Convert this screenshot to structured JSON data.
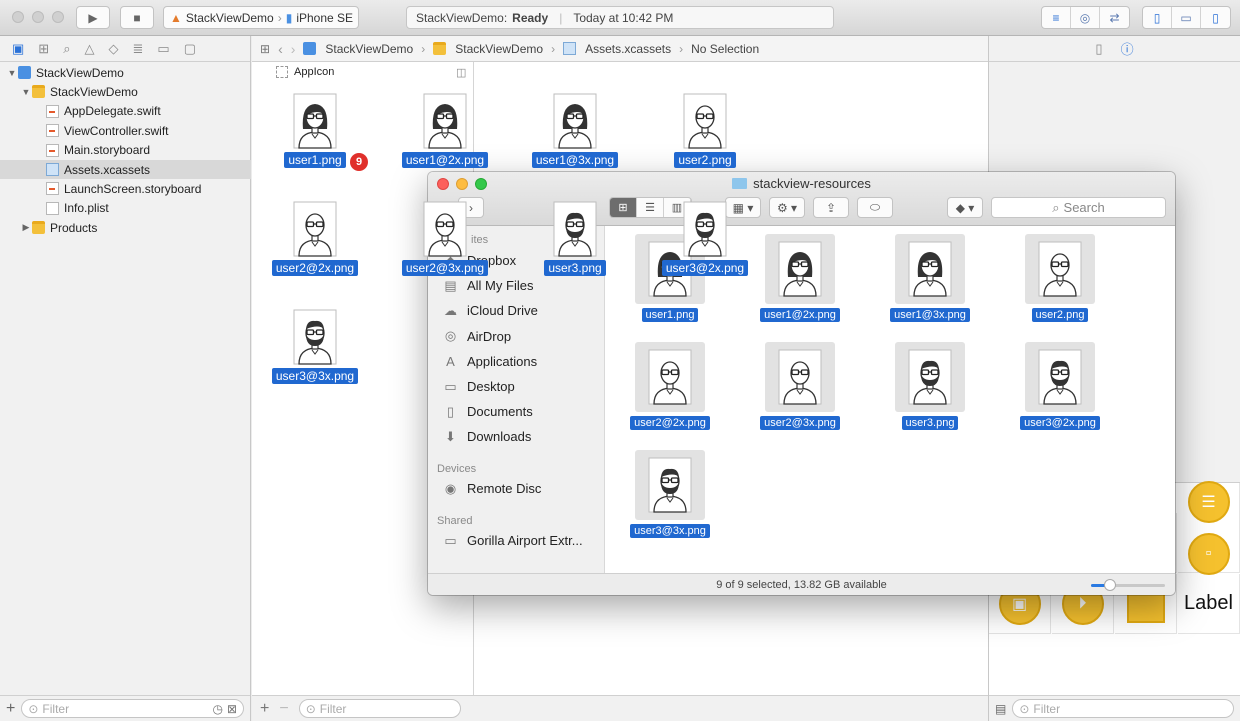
{
  "toolbar": {
    "scheme_project": "StackViewDemo",
    "scheme_device": "iPhone SE",
    "status_project": "StackViewDemo:",
    "status_state": "Ready",
    "status_time": "Today at 10:42 PM"
  },
  "navigator": {
    "tree": [
      {
        "label": "StackViewDemo",
        "kind": "project",
        "indent": 0,
        "open": true
      },
      {
        "label": "StackViewDemo",
        "kind": "folder",
        "indent": 1,
        "open": true
      },
      {
        "label": "AppDelegate.swift",
        "kind": "file",
        "indent": 2
      },
      {
        "label": "ViewController.swift",
        "kind": "file",
        "indent": 2
      },
      {
        "label": "Main.storyboard",
        "kind": "file",
        "indent": 2
      },
      {
        "label": "Assets.xcassets",
        "kind": "assets",
        "indent": 2,
        "selected": true
      },
      {
        "label": "LaunchScreen.storyboard",
        "kind": "file",
        "indent": 2
      },
      {
        "label": "Info.plist",
        "kind": "plist",
        "indent": 2
      },
      {
        "label": "Products",
        "kind": "folder",
        "indent": 1,
        "open": false
      }
    ],
    "filter_placeholder": "Filter"
  },
  "jumpbar": {
    "crumbs": [
      "StackViewDemo",
      "StackViewDemo",
      "Assets.xcassets",
      "No Selection"
    ]
  },
  "asset_list": {
    "appicon": "AppIcon",
    "filter_placeholder": "Filter"
  },
  "drag": {
    "badge_count": "9",
    "items": [
      {
        "label": "user1.png",
        "avatar": "woman"
      },
      {
        "label": "user1@2x.png",
        "avatar": "woman"
      },
      {
        "label": "user1@3x.png",
        "avatar": "woman"
      },
      {
        "label": "user2.png",
        "avatar": "bald"
      },
      {
        "label": "user2@2x.png",
        "avatar": "bald"
      },
      {
        "label": "user2@3x.png",
        "avatar": "bald"
      },
      {
        "label": "user3.png",
        "avatar": "beard"
      },
      {
        "label": "user3@2x.png",
        "avatar": "beard"
      },
      {
        "label": "user3@3x.png",
        "avatar": "beard"
      }
    ]
  },
  "finder": {
    "title": "stackview-resources",
    "search_placeholder": "Search",
    "sidebar": {
      "favorites_head": "ites",
      "devices_head": "Devices",
      "shared_head": "Shared",
      "favorites": [
        "Dropbox",
        "All My Files",
        "iCloud Drive",
        "AirDrop",
        "Applications",
        "Desktop",
        "Documents",
        "Downloads"
      ],
      "devices": [
        "Remote Disc"
      ],
      "shared": [
        "Gorilla Airport Extr..."
      ]
    },
    "files": [
      {
        "label": "user1.png",
        "avatar": "woman"
      },
      {
        "label": "user1@2x.png",
        "avatar": "woman"
      },
      {
        "label": "user1@3x.png",
        "avatar": "woman"
      },
      {
        "label": "user2.png",
        "avatar": "bald"
      },
      {
        "label": "user2@2x.png",
        "avatar": "bald"
      },
      {
        "label": "user2@3x.png",
        "avatar": "bald"
      },
      {
        "label": "user3.png",
        "avatar": "beard"
      },
      {
        "label": "user3@2x.png",
        "avatar": "beard"
      },
      {
        "label": "user3@3x.png",
        "avatar": "beard"
      }
    ],
    "status": "9 of 9 selected, 13.82 GB available",
    "icon_size_level": 0.25
  },
  "library": {
    "label_item": "Label",
    "filter_placeholder": "Filter"
  }
}
